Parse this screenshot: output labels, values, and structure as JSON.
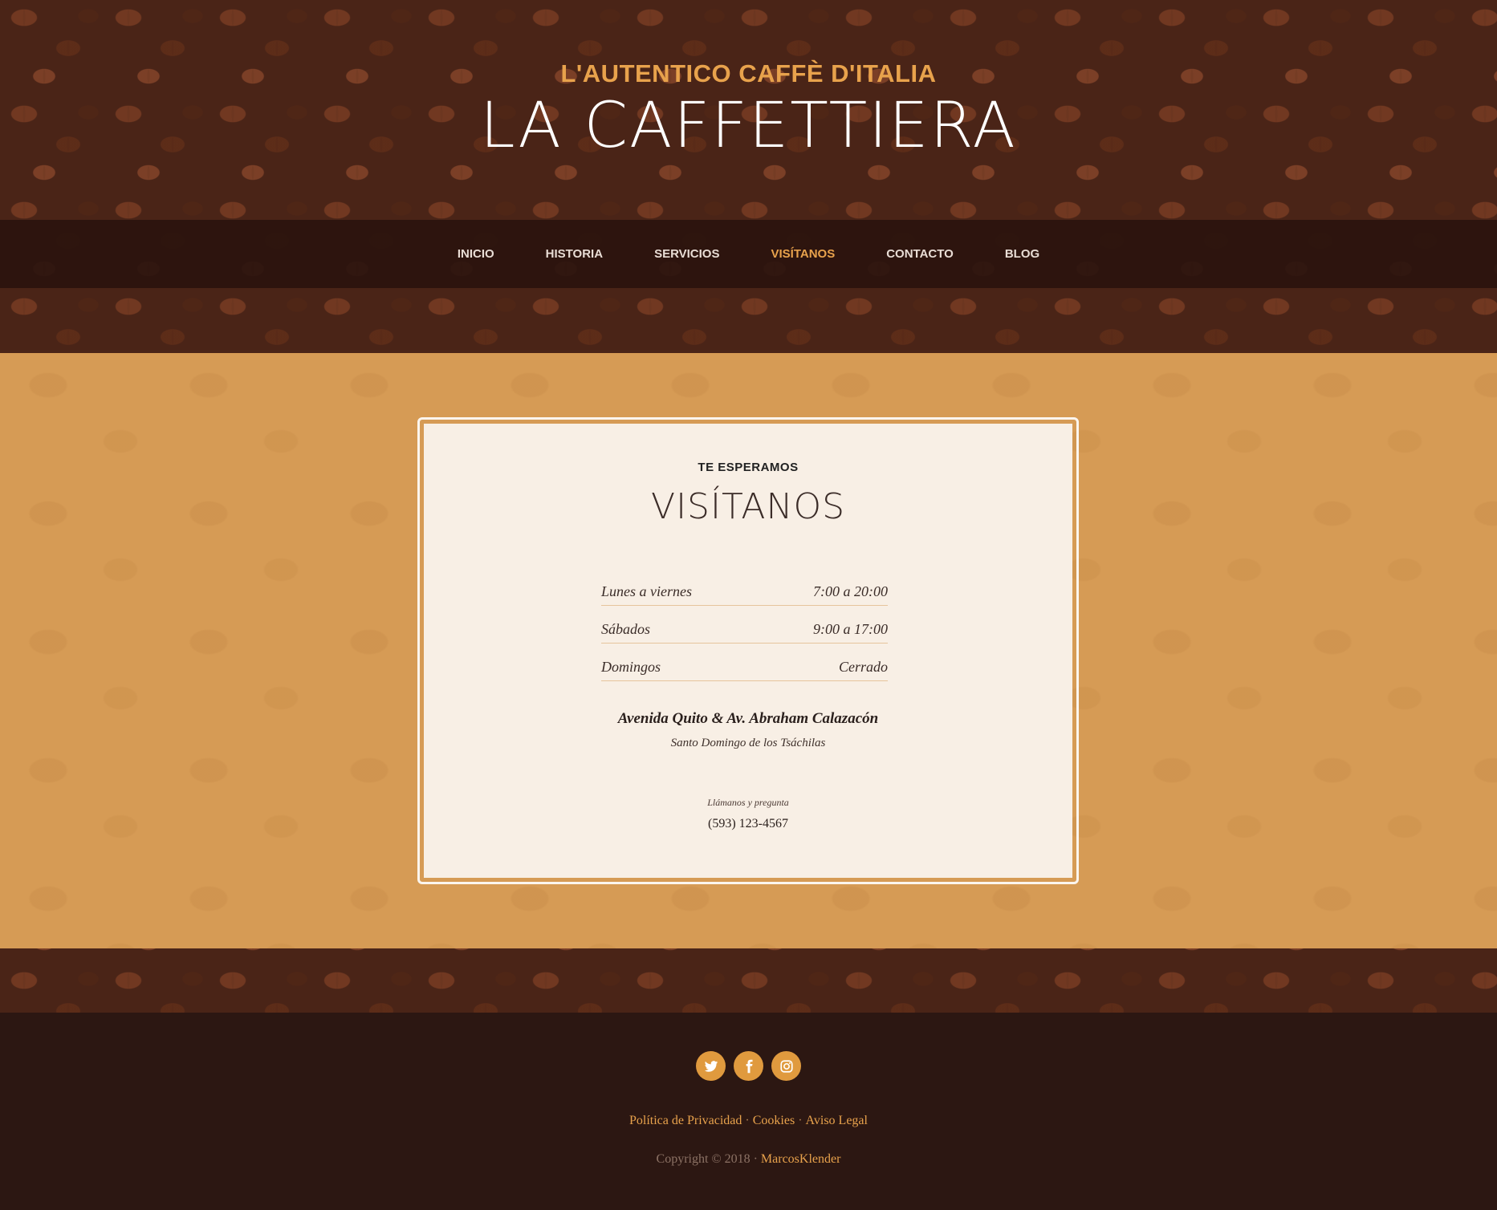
{
  "header": {
    "tagline": "L'AUTENTICO CAFFÈ D'ITALIA",
    "title": "LA CAFFETTIERA"
  },
  "nav": {
    "items": [
      {
        "label": "INICIO",
        "active": false
      },
      {
        "label": "HISTORIA",
        "active": false
      },
      {
        "label": "SERVICIOS",
        "active": false
      },
      {
        "label": "VISÍTANOS",
        "active": true
      },
      {
        "label": "CONTACTO",
        "active": false
      },
      {
        "label": "BLOG",
        "active": false
      }
    ]
  },
  "visit": {
    "kicker": "TE ESPERAMOS",
    "heading": "VISÍTANOS",
    "hours": [
      {
        "day": "Lunes a viernes",
        "time": "7:00 a 20:00"
      },
      {
        "day": "Sábados",
        "time": "9:00 a 17:00"
      },
      {
        "day": "Domingos",
        "time": "Cerrado"
      }
    ],
    "address": "Avenida Quito & Av. Abraham Calazacón",
    "city": "Santo Domingo de los Tsáchilas",
    "call_label": "Llámanos y pregunta",
    "phone": "(593) 123-4567"
  },
  "footer": {
    "social": [
      {
        "icon": "twitter-icon"
      },
      {
        "icon": "facebook-icon"
      },
      {
        "icon": "instagram-icon"
      }
    ],
    "links": {
      "privacy": "Política de Privacidad",
      "cookies": "Cookies",
      "legal": "Aviso Legal",
      "separator": "·"
    },
    "copyright": "Copyright © 2018 ·",
    "author": "MarcosKlender"
  },
  "colors": {
    "accent": "#e8a24c",
    "section_bg": "#d69b55",
    "card_bg": "#f8efe5",
    "dark": "#2c1712"
  }
}
